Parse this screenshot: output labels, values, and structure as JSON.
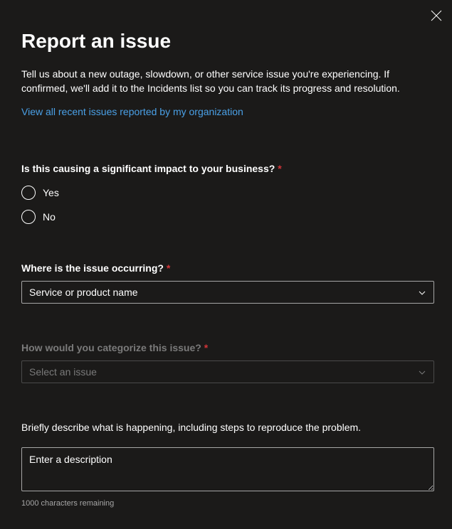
{
  "header": {
    "title": "Report an issue",
    "description": "Tell us about a new outage, slowdown, or other service issue you're experiencing. If confirmed, we'll add it to the Incidents list so you can track its progress and resolution.",
    "link_text": "View all recent issues reported by my organization"
  },
  "impact": {
    "label": "Is this causing a significant impact to your business?",
    "required": "*",
    "options": {
      "yes": "Yes",
      "no": "No"
    }
  },
  "location": {
    "label": "Where is the issue occurring?",
    "required": "*",
    "placeholder": "Service or product name"
  },
  "category": {
    "label": "How would you categorize this issue?",
    "required": "*",
    "placeholder": "Select an issue"
  },
  "description_field": {
    "label": "Briefly describe what is happening, including steps to reproduce the problem.",
    "placeholder": "Enter a description",
    "char_count": "1000 characters remaining"
  }
}
